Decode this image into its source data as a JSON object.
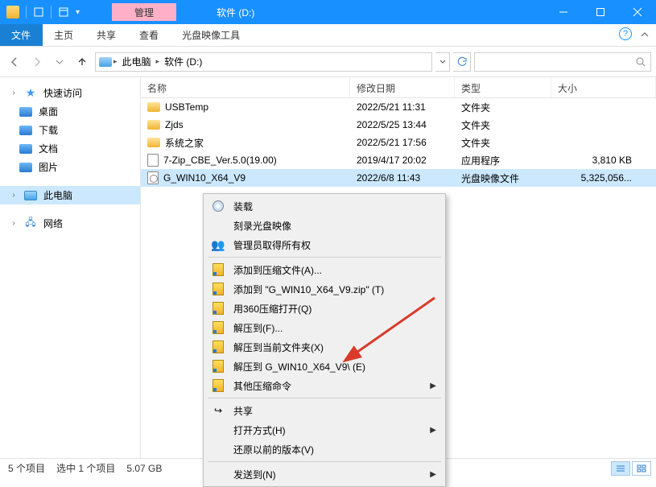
{
  "titlebar": {
    "contextual_tab": "管理",
    "app_title": "软件 (D:)"
  },
  "ribbon": {
    "file": "文件",
    "home": "主页",
    "share": "共享",
    "view": "查看",
    "tool": "光盘映像工具"
  },
  "address": {
    "this_pc": "此电脑",
    "drive": "软件 (D:)",
    "search_placeholder": ""
  },
  "sidebar": {
    "quick": "快速访问",
    "desktop": "桌面",
    "downloads": "下载",
    "documents": "文档",
    "pictures": "图片",
    "this_pc": "此电脑",
    "network": "网络"
  },
  "columns": {
    "name": "名称",
    "date": "修改日期",
    "type": "类型",
    "size": "大小"
  },
  "rows": [
    {
      "name": "USBTemp",
      "date": "2022/5/21 11:31",
      "type": "文件夹",
      "size": "",
      "icon": "folder"
    },
    {
      "name": "Zjds",
      "date": "2022/5/25 13:44",
      "type": "文件夹",
      "size": "",
      "icon": "folder"
    },
    {
      "name": "系统之家",
      "date": "2022/5/21 17:56",
      "type": "文件夹",
      "size": "",
      "icon": "folder"
    },
    {
      "name": "7-Zip_CBE_Ver.5.0(19.00)",
      "date": "2019/4/17 20:02",
      "type": "应用程序",
      "size": "3,810 KB",
      "icon": "exe"
    },
    {
      "name": "G_WIN10_X64_V9",
      "date": "2022/6/8 11:43",
      "type": "光盘映像文件",
      "size": "5,325,056...",
      "icon": "iso",
      "selected": true
    }
  ],
  "status": {
    "count": "5 个项目",
    "selection": "选中 1 个项目",
    "size": "5.07 GB"
  },
  "ctx": {
    "mount": "装载",
    "burn": "刻录光盘映像",
    "admin": "管理员取得所有权",
    "addzip": "添加到压缩文件(A)...",
    "addzip2": "添加到 \"G_WIN10_X64_V9.zip\" (T)",
    "openwith360": "用360压缩打开(Q)",
    "extractto": "解压到(F)...",
    "extracthere": "解压到当前文件夹(X)",
    "extractdir": "解压到 G_WIN10_X64_V9\\ (E)",
    "morezip": "其他压缩命令",
    "share": "共享",
    "openwith": "打开方式(H)",
    "restore": "还原以前的版本(V)",
    "sendto": "发送到(N)"
  }
}
